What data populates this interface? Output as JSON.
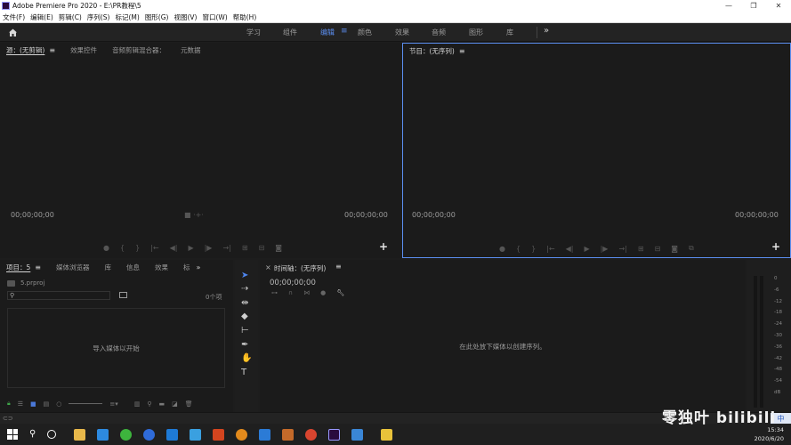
{
  "window": {
    "title": "Adobe Premiere Pro 2020 - E:\\PR教程\\5",
    "controls": [
      "—",
      "❐",
      "✕"
    ]
  },
  "menu": [
    "文件(F)",
    "编辑(E)",
    "剪辑(C)",
    "序列(S)",
    "标记(M)",
    "图形(G)",
    "视图(V)",
    "窗口(W)",
    "帮助(H)"
  ],
  "workspaces": {
    "tabs": [
      "学习",
      "组件",
      "编辑",
      "颜色",
      "效果",
      "音频",
      "图形",
      "库"
    ],
    "active": "编辑",
    "menu_glyph": "≡",
    "more_glyph": "»"
  },
  "source_panel": {
    "tabs": [
      "源：(无剪辑)",
      "效果控件",
      "音频剪辑混合器：",
      "元数据"
    ],
    "menu_glyph": "≡",
    "timecode_left": "00;00;00;00",
    "timecode_right": "00;00;00;00"
  },
  "program_panel": {
    "title": "节目：(无序列)",
    "menu_glyph": "≡",
    "timecode_left": "00;00;00;00",
    "timecode_right": "00;00;00;00"
  },
  "project_panel": {
    "tabs": [
      "项目：5",
      "媒体浏览器",
      "库",
      "信息",
      "效果",
      "标"
    ],
    "menu_glyph": "≡",
    "more_glyph": "»",
    "file_name": "5.prproj",
    "item_count": "0个项",
    "drop_hint": "导入媒体以开始"
  },
  "timeline_panel": {
    "title": "时间轴：(无序列)",
    "menu_glyph": "≡",
    "close_glyph": "×",
    "timecode": "00;00;00;00",
    "drop_hint": "在此处放下媒体以创建序列。"
  },
  "audio_meter": {
    "labels": [
      "0",
      "-6",
      "-12",
      "-18",
      "-24",
      "-30",
      "-36",
      "-42",
      "-48",
      "-54",
      "dB"
    ]
  },
  "statusbar": {
    "ime_label": "中"
  },
  "taskbar": {
    "time": "15:34",
    "date": "2020/6/20"
  },
  "watermark": {
    "text": "零独叶 bilibili"
  },
  "colors": {
    "accent": "#5b8ef0",
    "panel_bg": "#1b1b1b",
    "lock_green": "#3fa64a"
  }
}
